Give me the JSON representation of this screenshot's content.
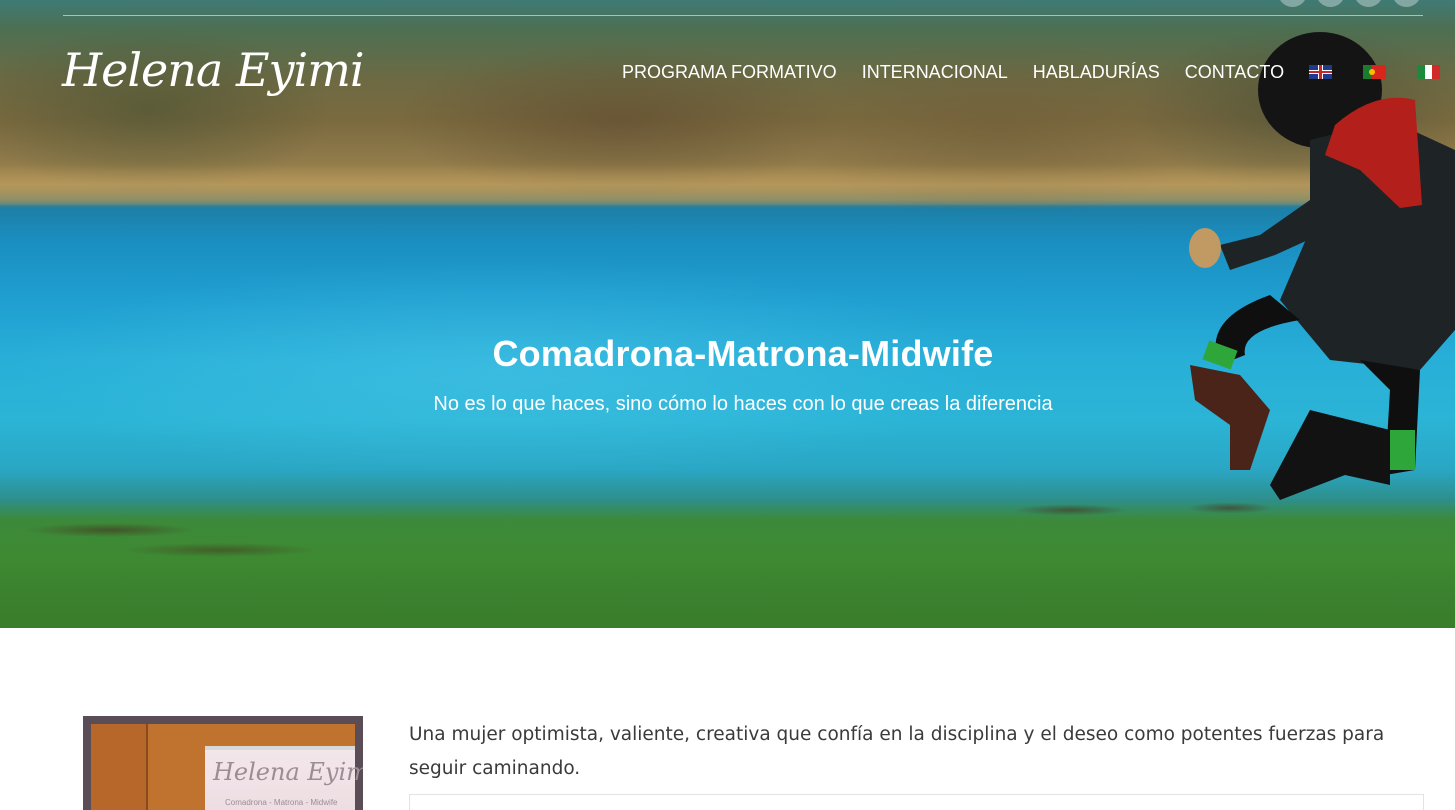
{
  "brand": {
    "logo_text": "Helena Eyimi"
  },
  "nav": {
    "items": [
      "PROGRAMA FORMATIVO",
      "INTERNACIONAL",
      "HABLADURÍAS",
      "CONTACTO"
    ],
    "languages": [
      {
        "code": "en",
        "icon": "uk-flag-icon"
      },
      {
        "code": "pt",
        "icon": "portugal-flag-icon"
      },
      {
        "code": "it",
        "icon": "italy-flag-icon"
      }
    ]
  },
  "hero": {
    "title": "Comadrona-Matrona-Midwife",
    "subtitle": "No es lo que haces, sino cómo lo haces con lo que creas la diferencia"
  },
  "content": {
    "photo_banner_logo": "Helena Eyimi",
    "photo_banner_sub": "Comadrona - Matrona - Midwife",
    "intro": "Una mujer optimista, valiente, creativa que confía en la disciplina y el deseo como potentes fuerzas para seguir caminando."
  },
  "colors": {
    "text": "#3a3a3a",
    "white": "#ffffff",
    "photo_frame": "#5a4d55"
  }
}
